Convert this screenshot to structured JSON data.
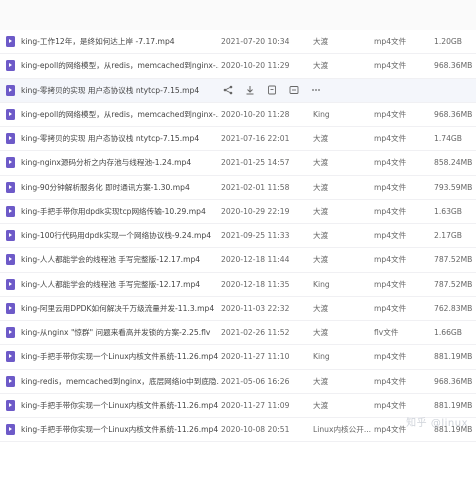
{
  "files": [
    {
      "name": "king-工作12年，是终如何达上岸 -7.17.mp4",
      "date": "2021-07-20 10:34",
      "owner": "大渡",
      "type": "mp4文件",
      "size": "1.20GB"
    },
    {
      "name": "king-epoll的网络模型，从redis，memcached到nginx-...",
      "date": "2020-10-20 11:29",
      "owner": "大渡",
      "type": "mp4文件",
      "size": "968.36MB"
    },
    {
      "name": "king-零拷贝的实现 用户态协议栈 ntytcp-7.15.mp4",
      "date": "",
      "owner": "",
      "type": "",
      "size": "",
      "actions": true
    },
    {
      "name": "king-epoll的网络模型，从redis，memcached到nginx-...",
      "date": "2020-10-20 11:28",
      "owner": "King",
      "type": "mp4文件",
      "size": "968.36MB"
    },
    {
      "name": "king-零拷贝的实现 用户态协议栈 ntytcp-7.15.mp4",
      "date": "2021-07-16 22:01",
      "owner": "大渡",
      "type": "mp4文件",
      "size": "1.74GB"
    },
    {
      "name": "king-nginx源码分析之内存池与线程池-1.24.mp4",
      "date": "2021-01-25 14:57",
      "owner": "大渡",
      "type": "mp4文件",
      "size": "858.24MB"
    },
    {
      "name": "king-90分钟解析服务化 即时通讯方案-1.30.mp4",
      "date": "2021-02-01 11:58",
      "owner": "大渡",
      "type": "mp4文件",
      "size": "793.59MB"
    },
    {
      "name": "king-手把手带你用dpdk实现tcp网络传输-10.29.mp4",
      "date": "2020-10-29 22:19",
      "owner": "大渡",
      "type": "mp4文件",
      "size": "1.63GB"
    },
    {
      "name": "king-100行代码用dpdk实现一个网络协议栈-9.24.mp4",
      "date": "2021-09-25 11:33",
      "owner": "大渡",
      "type": "mp4文件",
      "size": "2.17GB"
    },
    {
      "name": "king-人人都能学会的线程池 手写完整版-12.17.mp4",
      "date": "2020-12-18 11:44",
      "owner": "大渡",
      "type": "mp4文件",
      "size": "787.52MB"
    },
    {
      "name": "king-人人都能学会的线程池 手写完整版-12.17.mp4",
      "date": "2020-12-18 11:35",
      "owner": "King",
      "type": "mp4文件",
      "size": "787.52MB"
    },
    {
      "name": "king-阿里云用DPDK如何解决千万级流量并发-11.3.mp4",
      "date": "2020-11-03 22:32",
      "owner": "大渡",
      "type": "mp4文件",
      "size": "762.83MB"
    },
    {
      "name": "king-从nginx \"惊群\" 问题来看高并发锁的方案-2.25.flv",
      "date": "2021-02-26 11:52",
      "owner": "大渡",
      "type": "flv文件",
      "size": "1.66GB"
    },
    {
      "name": "king-手把手带你实现一个Linux内核文件系统-11.26.mp4",
      "date": "2020-11-27 11:10",
      "owner": "King",
      "type": "mp4文件",
      "size": "881.19MB"
    },
    {
      "name": "king-redis，memcached到nginx，底层网络io中到底隐...",
      "date": "2021-05-06 16:26",
      "owner": "大渡",
      "type": "mp4文件",
      "size": "968.36MB"
    },
    {
      "name": "king-手把手带你实现一个Linux内核文件系统-11.26.mp4",
      "date": "2020-11-27 11:09",
      "owner": "大渡",
      "type": "mp4文件",
      "size": "881.19MB"
    },
    {
      "name": "king-手把手带你实现一个Linux内核文件系统-11.26.mp4",
      "date": "2020-10-08 20:51",
      "owner": "Linux内核公开...",
      "type": "mp4文件",
      "size": "881.19MB"
    }
  ],
  "watermark": "知乎 @linux",
  "colors": {
    "file_icon": "#6d5ac8",
    "row_highlight": "#f4f6fb"
  }
}
